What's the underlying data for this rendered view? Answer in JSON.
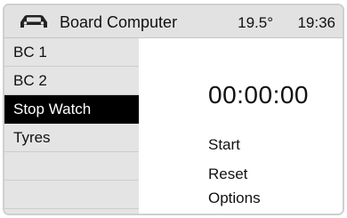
{
  "header": {
    "icon": "car-icon",
    "title": "Board Computer",
    "temperature": "19.5°",
    "time": "19:36"
  },
  "menu": {
    "items": [
      {
        "label": "BC 1",
        "selected": false
      },
      {
        "label": "BC 2",
        "selected": false
      },
      {
        "label": "Stop Watch",
        "selected": true
      },
      {
        "label": "Tyres",
        "selected": false
      }
    ]
  },
  "stopwatch": {
    "display": "00:00:00",
    "actions": [
      "Start",
      "Reset",
      "Options"
    ]
  },
  "colors": {
    "selected_background": "#000000",
    "selected_text": "#ffffff",
    "sidebar_background": "#e4e4e4",
    "content_background": "#ffffff"
  }
}
